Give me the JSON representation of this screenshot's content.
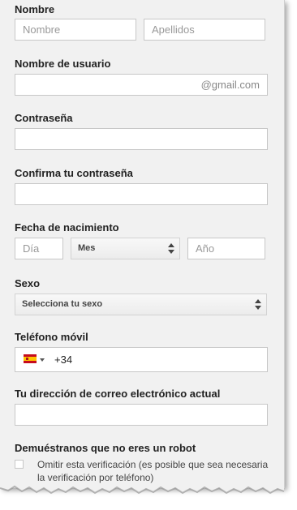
{
  "name": {
    "label": "Nombre",
    "first_placeholder": "Nombre",
    "last_placeholder": "Apellidos"
  },
  "username": {
    "label": "Nombre de usuario",
    "suffix": "@gmail.com"
  },
  "password": {
    "label": "Contraseña"
  },
  "confirm_password": {
    "label": "Confirma tu contraseña"
  },
  "birthdate": {
    "label": "Fecha de nacimiento",
    "day_placeholder": "Día",
    "month_value": "Mes",
    "year_placeholder": "Año"
  },
  "gender": {
    "label": "Sexo",
    "select_value": "Selecciona tu sexo"
  },
  "phone": {
    "label": "Teléfono móvil",
    "country_flag": "spain-flag-icon",
    "dial_code": "+34"
  },
  "current_email": {
    "label": "Tu dirección de correo electrónico actual"
  },
  "robot": {
    "label": "Demuéstranos que no eres un robot",
    "skip_text": "Omitir esta verificación (es posible que sea necesaria la verificación por teléfono)"
  }
}
